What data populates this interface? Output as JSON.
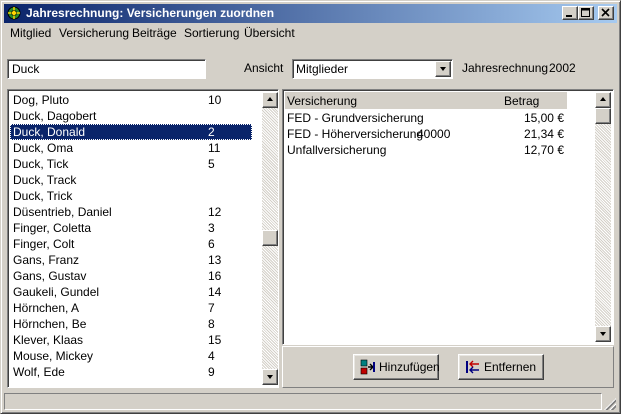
{
  "window": {
    "title": "Jahresrechnung: Versicherungen zuordnen",
    "minimize": "_",
    "maximize": "□",
    "close": "×"
  },
  "menu": [
    "Mitglied",
    "Versicherung",
    "Beiträge",
    "Sortierung",
    "Übersicht"
  ],
  "search": {
    "value": "Duck"
  },
  "ansicht": {
    "label": "Ansicht",
    "value": "Mitglieder"
  },
  "jahresrechnung": {
    "label": "Jahresrechnung",
    "year": "2002"
  },
  "members": [
    {
      "name": "Dog, Pluto",
      "num": "10"
    },
    {
      "name": "Duck, Dagobert",
      "num": ""
    },
    {
      "name": "Duck, Donald",
      "num": "2",
      "selected": true
    },
    {
      "name": "Duck, Oma",
      "num": "11"
    },
    {
      "name": "Duck, Tick",
      "num": "5"
    },
    {
      "name": "Duck, Track",
      "num": ""
    },
    {
      "name": "Duck, Trick",
      "num": ""
    },
    {
      "name": "Düsentrieb, Daniel",
      "num": "12"
    },
    {
      "name": "Finger, Coletta",
      "num": "3"
    },
    {
      "name": "Finger, Colt",
      "num": "6"
    },
    {
      "name": "Gans, Franz",
      "num": "13"
    },
    {
      "name": "Gans, Gustav",
      "num": "16"
    },
    {
      "name": "Gaukeli, Gundel",
      "num": "14"
    },
    {
      "name": "Hörnchen, A",
      "num": "7"
    },
    {
      "name": "Hörnchen, Be",
      "num": "8"
    },
    {
      "name": "Klever, Klaas",
      "num": "15"
    },
    {
      "name": "Mouse, Mickey",
      "num": "4"
    },
    {
      "name": "Wolf, Ede",
      "num": "9"
    }
  ],
  "insurance_table": {
    "headers": {
      "versicherung": "Versicherung",
      "betrag": "Betrag"
    },
    "rows": [
      {
        "versicherung": "FED - Grundversicherung",
        "extra": "",
        "betrag": "15,00 €"
      },
      {
        "versicherung": "FED - Höherversicherung",
        "extra": "40000",
        "betrag": "21,34 €"
      },
      {
        "versicherung": "Unfallversicherung",
        "extra": "",
        "betrag": "12,70 €"
      }
    ]
  },
  "buttons": {
    "add": "Hinzufügen",
    "remove": "Entfernen"
  },
  "icons": {
    "app": "lifebuoy-icon",
    "add": "add-arrow-icon",
    "remove": "remove-arrow-icon"
  },
  "colors": {
    "titlebar_start": "#0a246a",
    "titlebar_end": "#a6caf0",
    "selection": "#0a246a",
    "face": "#d4d0c8"
  }
}
